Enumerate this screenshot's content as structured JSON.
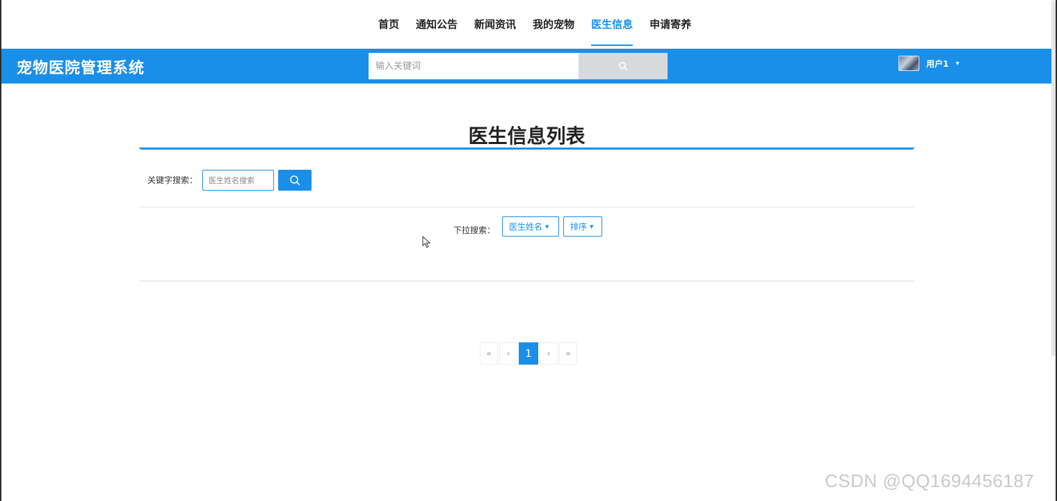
{
  "topnav": {
    "items": [
      {
        "label": "首页"
      },
      {
        "label": "通知公告"
      },
      {
        "label": "新闻资讯"
      },
      {
        "label": "我的宠物"
      },
      {
        "label": "医生信息"
      },
      {
        "label": "申请寄养"
      }
    ],
    "active_index": 4
  },
  "header": {
    "brand": "宠物医院管理系统",
    "search_placeholder": "输入关键词",
    "username": "用户1"
  },
  "main": {
    "title": "医生信息列表",
    "keyword_label": "关键字搜索：",
    "keyword_placeholder": "医生姓名搜索",
    "dropdown_label": "下拉搜索：",
    "dropdown_name": "医生姓名",
    "dropdown_sort": "排序"
  },
  "pagination": {
    "first": "«",
    "prev": "‹",
    "current": "1",
    "next": "›",
    "last": "»"
  },
  "watermark": "CSDN @QQ1694456187",
  "colors": {
    "accent": "#1a8fe9",
    "header_bg": "#1a8fe9",
    "search_button": "#d7d9dc"
  }
}
